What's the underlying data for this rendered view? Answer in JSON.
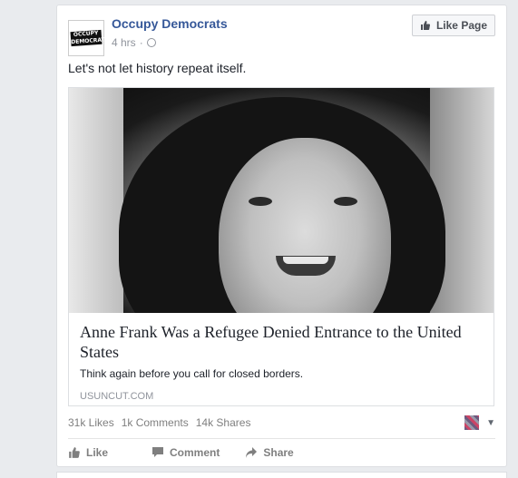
{
  "post": {
    "page_name": "Occupy Democrats",
    "avatar_text": "OCCUPY DEMOCRATS",
    "time": "4 hrs",
    "separator": "·",
    "like_page_label": "Like Page",
    "text": "Let's not let history repeat itself."
  },
  "link_preview": {
    "title": "Anne Frank Was a Refugee Denied Entrance to the United States",
    "description": "Think again before you call for closed borders.",
    "domain": "USUNCUT.COM"
  },
  "stats": {
    "likes": "31k Likes",
    "comments": "1k Comments",
    "shares": "14k Shares"
  },
  "actions": {
    "like": "Like",
    "comment": "Comment",
    "share": "Share"
  },
  "colors": {
    "link_blue": "#365899",
    "meta_gray": "#90949c",
    "background": "#e9ebee"
  },
  "icons": [
    "globe-icon",
    "thumbs-up-icon",
    "comment-icon",
    "share-icon",
    "chevron-down-icon"
  ]
}
